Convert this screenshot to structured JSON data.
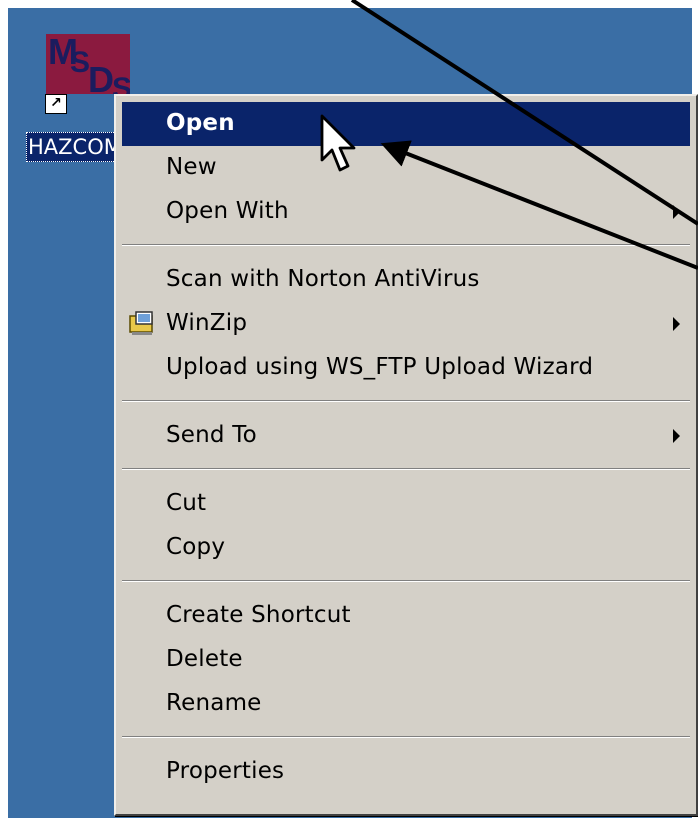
{
  "desktop": {
    "shortcut": {
      "label": "HAZCOM MSDS",
      "logo_letters": [
        "M",
        "S",
        "D",
        "S"
      ],
      "icon": "msds-shortcut-icon",
      "overlay_icon": "shortcut-arrow-icon",
      "overlay_glyph": "↗",
      "colors": {
        "icon_background": "#8b1a3f",
        "logo_text": "#1b1c5e"
      }
    }
  },
  "context_menu": {
    "groups": [
      [
        {
          "label": "Open",
          "highlighted": true
        },
        {
          "label": "New"
        },
        {
          "label": "Open With",
          "submenu": true
        }
      ],
      [
        {
          "label": "Scan with Norton AntiVirus"
        },
        {
          "label": "WinZip",
          "submenu": true,
          "icon": "winzip-icon"
        },
        {
          "label": "Upload using WS_FTP Upload Wizard"
        }
      ],
      [
        {
          "label": "Send To",
          "submenu": true
        }
      ],
      [
        {
          "label": "Cut"
        },
        {
          "label": "Copy"
        }
      ],
      [
        {
          "label": "Create Shortcut"
        },
        {
          "label": "Delete"
        },
        {
          "label": "Rename"
        }
      ],
      [
        {
          "label": "Properties"
        }
      ]
    ]
  },
  "colors": {
    "desktop_background": "#3a6ea5",
    "menu_background": "#d4d0c8",
    "selection": "#0a246a",
    "selection_text": "#ffffff"
  },
  "pointer": {
    "icon": "arrow-cursor-icon"
  },
  "callouts": {
    "icon": "annotation-arrow-icon"
  }
}
